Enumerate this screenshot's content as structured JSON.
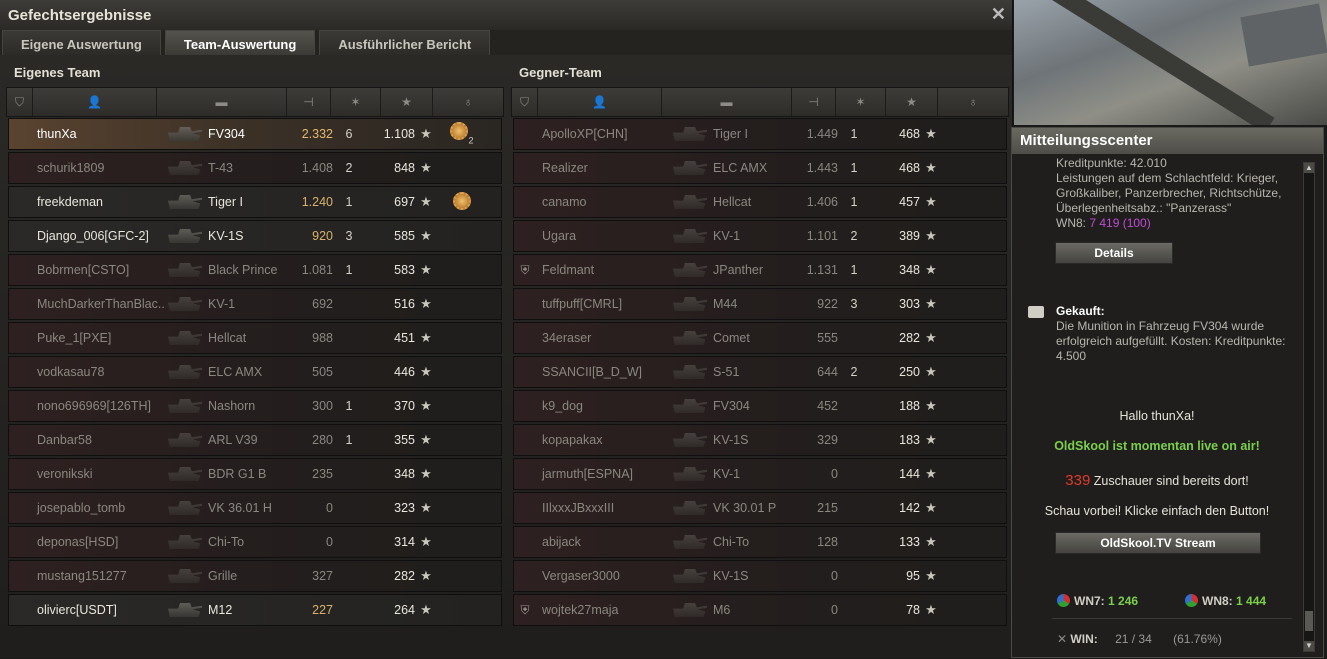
{
  "window": {
    "title": "Gefechtsergebnisse",
    "tabs": [
      "Eigene Auswertung",
      "Team-Auswertung",
      "Ausführlicher Bericht"
    ]
  },
  "own_team": {
    "title": "Eigenes Team",
    "rows": [
      {
        "name": "thunXa",
        "tank": "FV304",
        "damage": "2.332",
        "kills": "6",
        "xp": "1.108",
        "medal": "2",
        "state": "me"
      },
      {
        "name": "schurik1809",
        "tank": "T-43",
        "damage": "1.408",
        "kills": "2",
        "xp": "848",
        "medal": "",
        "state": "dead"
      },
      {
        "name": "freekdeman",
        "tank": "Tiger I",
        "damage": "1.240",
        "kills": "1",
        "xp": "697",
        "medal": "1",
        "state": "alive"
      },
      {
        "name": "Django_006[GFC-2]",
        "tank": "KV-1S",
        "damage": "920",
        "kills": "3",
        "xp": "585",
        "medal": "",
        "state": "alive"
      },
      {
        "name": "Bobrmen[CSTO]",
        "tank": "Black Prince",
        "damage": "1.081",
        "kills": "1",
        "xp": "583",
        "medal": "",
        "state": "dead"
      },
      {
        "name": "MuchDarkerThanBlac..",
        "tank": "KV-1",
        "damage": "692",
        "kills": "",
        "xp": "516",
        "medal": "",
        "state": "dead"
      },
      {
        "name": "Puke_1[PXE]",
        "tank": "Hellcat",
        "damage": "988",
        "kills": "",
        "xp": "451",
        "medal": "",
        "state": "dead"
      },
      {
        "name": "vodkasau78",
        "tank": "ELC AMX",
        "damage": "505",
        "kills": "",
        "xp": "446",
        "medal": "",
        "state": "dead"
      },
      {
        "name": "nono696969[126TH]",
        "tank": "Nashorn",
        "damage": "300",
        "kills": "1",
        "xp": "370",
        "medal": "",
        "state": "dead"
      },
      {
        "name": "Danbar58",
        "tank": "ARL V39",
        "damage": "280",
        "kills": "1",
        "xp": "355",
        "medal": "",
        "state": "dead"
      },
      {
        "name": "veronikski",
        "tank": "BDR G1 B",
        "damage": "235",
        "kills": "",
        "xp": "348",
        "medal": "",
        "state": "dead"
      },
      {
        "name": "josepablo_tomb",
        "tank": "VK 36.01 H",
        "damage": "0",
        "kills": "",
        "xp": "323",
        "medal": "",
        "state": "dead"
      },
      {
        "name": "deponas[HSD]",
        "tank": "Chi-To",
        "damage": "0",
        "kills": "",
        "xp": "314",
        "medal": "",
        "state": "dead"
      },
      {
        "name": "mustang151277",
        "tank": "Grille",
        "damage": "327",
        "kills": "",
        "xp": "282",
        "medal": "",
        "state": "dead"
      },
      {
        "name": "olivierc[USDT]",
        "tank": "M12",
        "damage": "227",
        "kills": "",
        "xp": "264",
        "medal": "",
        "state": "alive"
      }
    ]
  },
  "enemy_team": {
    "title": "Gegner-Team",
    "rows": [
      {
        "name": "ApolloXP[CHN]",
        "tank": "Tiger I",
        "damage": "1.449",
        "kills": "1",
        "xp": "468",
        "icon": ""
      },
      {
        "name": "Realizer",
        "tank": "ELC AMX",
        "damage": "1.443",
        "kills": "1",
        "xp": "468",
        "icon": ""
      },
      {
        "name": "canamo",
        "tank": "Hellcat",
        "damage": "1.406",
        "kills": "1",
        "xp": "457",
        "icon": ""
      },
      {
        "name": "Ugara",
        "tank": "KV-1",
        "damage": "1.101",
        "kills": "2",
        "xp": "389",
        "icon": ""
      },
      {
        "name": "Feldmant",
        "tank": "JPanther",
        "damage": "1.131",
        "kills": "1",
        "xp": "348",
        "icon": "shield"
      },
      {
        "name": "tuffpuff[CMRL]",
        "tank": "M44",
        "damage": "922",
        "kills": "3",
        "xp": "303",
        "icon": ""
      },
      {
        "name": "34eraser",
        "tank": "Comet",
        "damage": "555",
        "kills": "",
        "xp": "282",
        "icon": ""
      },
      {
        "name": "SSANCII[B_D_W]",
        "tank": "S-51",
        "damage": "644",
        "kills": "2",
        "xp": "250",
        "icon": ""
      },
      {
        "name": "k9_dog",
        "tank": "FV304",
        "damage": "452",
        "kills": "",
        "xp": "188",
        "icon": ""
      },
      {
        "name": "kopapakax",
        "tank": "KV-1S",
        "damage": "329",
        "kills": "",
        "xp": "183",
        "icon": ""
      },
      {
        "name": "jarmuth[ESPNA]",
        "tank": "KV-1",
        "damage": "0",
        "kills": "",
        "xp": "144",
        "icon": ""
      },
      {
        "name": "IIlxxxJBxxxIII",
        "tank": "VK 30.01 P",
        "damage": "215",
        "kills": "",
        "xp": "142",
        "icon": ""
      },
      {
        "name": "abijack",
        "tank": "Chi-To",
        "damage": "128",
        "kills": "",
        "xp": "133",
        "icon": ""
      },
      {
        "name": "Vergaser3000",
        "tank": "KV-1S",
        "damage": "0",
        "kills": "",
        "xp": "95",
        "icon": ""
      },
      {
        "name": "wojtek27maja",
        "tank": "M6",
        "damage": "0",
        "kills": "",
        "xp": "78",
        "icon": "shield"
      }
    ]
  },
  "notifications": {
    "title": "Mitteilungsscenter",
    "msg1_line1": "Kreditpunkte: 42.010",
    "msg1_line2": "Leistungen auf dem Schlachtfeld: Krieger, Großkaliber, Panzerbrecher, Richtschütze, Überlegenheitsabz.: \"Panzerass\"",
    "wn8_label": "WN8:",
    "wn8_value": "7 419 (100)",
    "details_btn": "Details",
    "msg2_title": "Gekauft:",
    "msg2_body": "Die Munition in Fahrzeug FV304 wurde erfolgreich aufgefüllt. Kosten: Kreditpunkte:  4.500",
    "hello": "Hallo thunXa!",
    "live": "OldSkool ist momentan live on air!",
    "viewers_num": "339",
    "viewers_text": "Zuschauer sind bereits dort!",
    "visit": "Schau vorbei! Klicke einfach den Button!",
    "stream_btn": "OldSkool.TV Stream",
    "wn7_label": "WN7:",
    "wn7_value": "1 246",
    "wn8b_label": "WN8:",
    "wn8b_value": "1 444",
    "win_label": "WIN:",
    "win_value": "21 / 34",
    "win_pct": "(61.76%)",
    "colors": {
      "wn8_purple": "#c04bd8",
      "green": "#7ad04a",
      "red": "#e03a2a"
    }
  }
}
